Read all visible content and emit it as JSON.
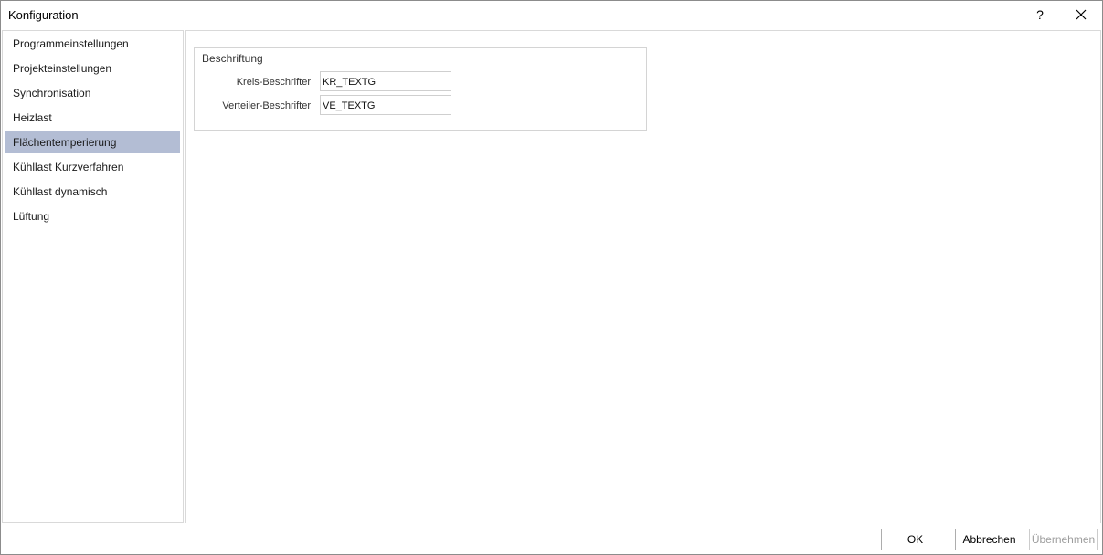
{
  "window": {
    "title": "Konfiguration",
    "help_label": "?",
    "help_icon": "question-mark-icon",
    "close_icon": "close-icon"
  },
  "sidebar": {
    "items": [
      {
        "label": "Programmeinstellungen",
        "selected": false
      },
      {
        "label": "Projekteinstellungen",
        "selected": false
      },
      {
        "label": "Synchronisation",
        "selected": false
      },
      {
        "label": "Heizlast",
        "selected": false
      },
      {
        "label": "Flächentemperierung",
        "selected": true
      },
      {
        "label": "Kühllast Kurzverfahren",
        "selected": false
      },
      {
        "label": "Kühllast dynamisch",
        "selected": false
      },
      {
        "label": "Lüftung",
        "selected": false
      }
    ],
    "selected_color": "#b3bdd4"
  },
  "main": {
    "group_title": "Beschriftung",
    "fields": [
      {
        "label": "Kreis-Beschrifter",
        "value": "KR_TEXTG"
      },
      {
        "label": "Verteiler-Beschrifter",
        "value": "VE_TEXTG"
      }
    ]
  },
  "buttons": {
    "ok": "OK",
    "cancel": "Abbrechen",
    "apply": "Übernehmen",
    "apply_enabled": false
  }
}
